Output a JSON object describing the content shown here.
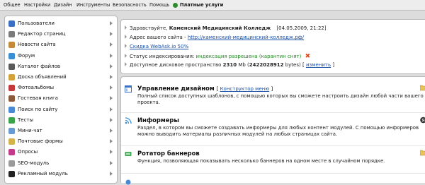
{
  "topmenu": {
    "items": [
      "Общее",
      "Настройки",
      "Дизайн",
      "Инструменты",
      "Безопасность",
      "Помощь"
    ],
    "paid_label": "Платные услуги"
  },
  "sidebar": {
    "items": [
      {
        "label": "Пользователи",
        "icon": "users-icon",
        "color": "#3a6fc4"
      },
      {
        "label": "Редактор страниц",
        "icon": "page-editor-icon",
        "color": "#7a7a7a"
      },
      {
        "label": "Новости сайта",
        "icon": "news-icon",
        "color": "#c48a3a"
      },
      {
        "label": "Форум",
        "icon": "forum-icon",
        "color": "#3a8fd4"
      },
      {
        "label": "Каталог файлов",
        "icon": "files-catalog-icon",
        "color": "#5a5a5a"
      },
      {
        "label": "Доска объявлений",
        "icon": "board-icon",
        "color": "#d4a23a"
      },
      {
        "label": "Фотоальбомы",
        "icon": "photo-albums-icon",
        "color": "#c43a3a"
      },
      {
        "label": "Гостевая книга",
        "icon": "guestbook-icon",
        "color": "#8a5a3a"
      },
      {
        "label": "Поиск по сайту",
        "icon": "search-icon",
        "color": "#4a8ad4"
      },
      {
        "label": "Тесты",
        "icon": "tests-icon",
        "color": "#3aa44a"
      },
      {
        "label": "Мини-чат",
        "icon": "mini-chat-icon",
        "color": "#6a9ad4"
      },
      {
        "label": "Почтовые формы",
        "icon": "mail-forms-icon",
        "color": "#d4b44a"
      },
      {
        "label": "Опросы",
        "icon": "polls-icon",
        "color": "#c43a8a"
      },
      {
        "label": "SEO-модуль",
        "icon": "seo-icon",
        "color": "#9a9a9a"
      },
      {
        "label": "Рекламный модуль",
        "icon": "ads-icon",
        "color": "#222222"
      }
    ]
  },
  "info": {
    "greeting_prefix": "Здравствуйте,",
    "name": "Каменский Медицинский Колледж",
    "datetime": "[04.05.2009, 21:22]",
    "address_label": "Адрес вашего сайта -",
    "address_link": "http://каменский-медицинский-колледж.рф/",
    "discount_link": "Скидка WebAsk.io 50%",
    "index_label": "Статус индексирования:",
    "index_status": "индексация разрешена (карантин снят)",
    "disk_label": "Доступное дисковое пространство",
    "disk_free": "2310",
    "disk_mb": "Mb (",
    "disk_bytes": "2422028912",
    "disk_bytes_label": "bytes) [",
    "disk_change": "изменить",
    "disk_close": "]"
  },
  "sections": [
    {
      "title": "Управление дизайном",
      "title_link": "Конструктор меню",
      "desc": "Полный список доступных шаблонов, с помощью которых вы сможете настроить дизайн любой части вашего проекта."
    },
    {
      "title": "Информеры",
      "desc": "Раздел, в котором вы сможете создавать информеры для любых контент модулей. С помощью информеров можно выводить материалы различных модулей на любых страницах сайта."
    },
    {
      "title": "Ротатор баннеров",
      "desc": "Функция, позволяющая показывать несколько баннеров на одном месте в случайном порядке."
    }
  ]
}
